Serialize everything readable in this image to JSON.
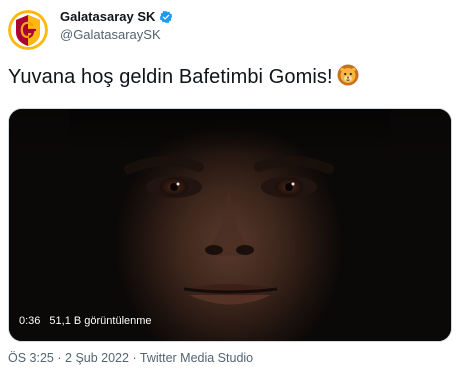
{
  "account": {
    "display_name": "Galatasaray SK",
    "handle": "@GalatasaraySK",
    "verified_icon": "verified-badge-icon",
    "avatar_icon": "galatasaray-crest-icon"
  },
  "tweet": {
    "text": "Yuvana hoş geldin Bafetimbi Gomis!",
    "emoji_icon": "lion-face-icon"
  },
  "video": {
    "duration": "0:36",
    "views": "51,1 B görüntülenme",
    "thumbnail_icon": "video-thumbnail-face"
  },
  "meta": {
    "time": "ÖS 3:25",
    "separator": "·",
    "date": "2 Şub 2022",
    "source": "Twitter Media Studio"
  },
  "colors": {
    "text_primary": "#0f1419",
    "text_secondary": "#536471",
    "verified_blue": "#1d9bf0",
    "crest_red": "#a90432",
    "crest_yellow": "#fdb912"
  }
}
